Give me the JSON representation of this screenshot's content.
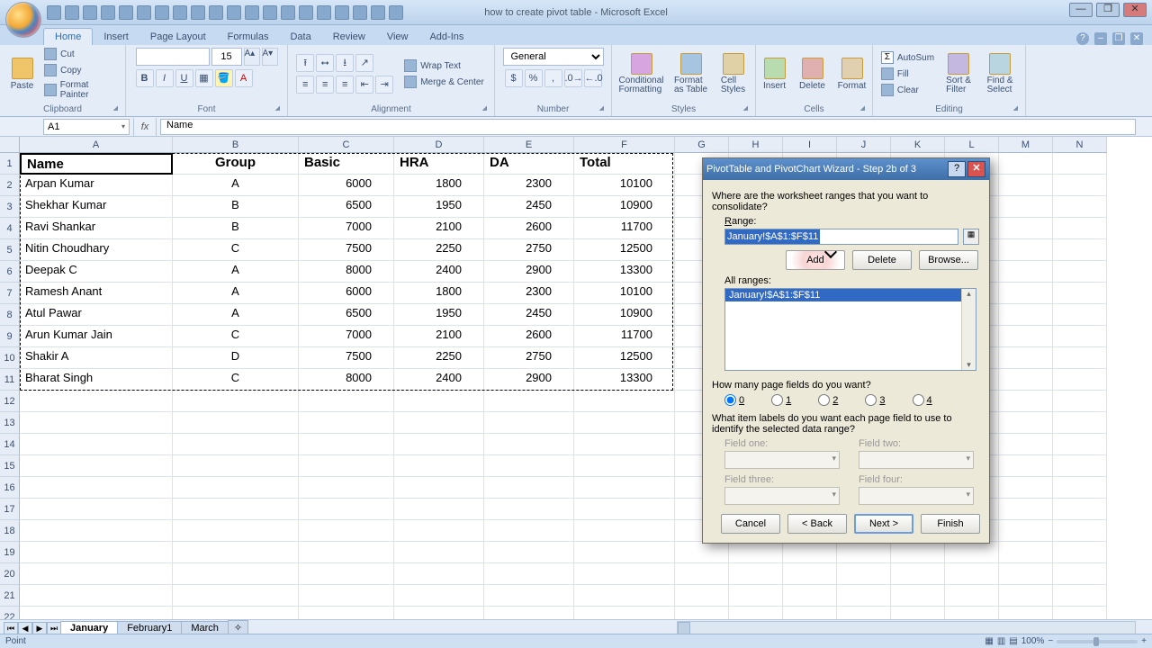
{
  "title": "how to create pivot table - Microsoft Excel",
  "tabs": [
    "Home",
    "Insert",
    "Page Layout",
    "Formulas",
    "Data",
    "Review",
    "View",
    "Add-Ins"
  ],
  "activeTab": "Home",
  "ribbon": {
    "clipboard": {
      "label": "Clipboard",
      "paste": "Paste",
      "cut": "Cut",
      "copy": "Copy",
      "fmtpainter": "Format Painter"
    },
    "font": {
      "label": "Font",
      "size": "15"
    },
    "alignment": {
      "label": "Alignment",
      "wrap": "Wrap Text",
      "merge": "Merge & Center"
    },
    "number": {
      "label": "Number",
      "general": "General"
    },
    "styles": {
      "label": "Styles",
      "cond": "Conditional\nFormatting",
      "fmt": "Format\nas Table",
      "cell": "Cell\nStyles"
    },
    "cells": {
      "label": "Cells",
      "insert": "Insert",
      "delete": "Delete",
      "format": "Format"
    },
    "editing": {
      "label": "Editing",
      "sum": "AutoSum",
      "fill": "Fill",
      "clear": "Clear",
      "sort": "Sort &\nFilter",
      "find": "Find &\nSelect"
    }
  },
  "namebox": "A1",
  "formula": "Name",
  "columns": [
    "A",
    "B",
    "C",
    "D",
    "E",
    "F",
    "G",
    "H",
    "I",
    "J",
    "K",
    "L",
    "M",
    "N"
  ],
  "headers": [
    "Name",
    "Group",
    "Basic",
    "HRA",
    "DA",
    "Total"
  ],
  "rows": [
    {
      "name": "Arpan Kumar",
      "group": "A",
      "basic": 6000,
      "hra": 1800,
      "da": 2300,
      "total": 10100
    },
    {
      "name": "Shekhar Kumar",
      "group": "B",
      "basic": 6500,
      "hra": 1950,
      "da": 2450,
      "total": 10900
    },
    {
      "name": "Ravi Shankar",
      "group": "B",
      "basic": 7000,
      "hra": 2100,
      "da": 2600,
      "total": 11700
    },
    {
      "name": "Nitin Choudhary",
      "group": "C",
      "basic": 7500,
      "hra": 2250,
      "da": 2750,
      "total": 12500
    },
    {
      "name": "Deepak C",
      "group": "A",
      "basic": 8000,
      "hra": 2400,
      "da": 2900,
      "total": 13300
    },
    {
      "name": "Ramesh Anant",
      "group": "A",
      "basic": 6000,
      "hra": 1800,
      "da": 2300,
      "total": 10100
    },
    {
      "name": "Atul Pawar",
      "group": "A",
      "basic": 6500,
      "hra": 1950,
      "da": 2450,
      "total": 10900
    },
    {
      "name": "Arun Kumar Jain",
      "group": "C",
      "basic": 7000,
      "hra": 2100,
      "da": 2600,
      "total": 11700
    },
    {
      "name": "Shakir A",
      "group": "D",
      "basic": 7500,
      "hra": 2250,
      "da": 2750,
      "total": 12500
    },
    {
      "name": "Bharat Singh",
      "group": "C",
      "basic": 8000,
      "hra": 2400,
      "da": 2900,
      "total": 13300
    }
  ],
  "sheets": [
    "January",
    "February1",
    "March"
  ],
  "activeSheet": "January",
  "status": "Point",
  "zoom": "100%",
  "dialog": {
    "title": "PivotTable and PivotChart Wizard - Step 2b of 3",
    "prompt": "Where are the worksheet ranges that you want to consolidate?",
    "rangeLabel": "Range:",
    "rangeValue": "January!$A$1:$F$11",
    "add": "Add",
    "delete": "Delete",
    "browse": "Browse...",
    "allRangesLabel": "All ranges:",
    "allRangesItem": "January!$A$1:$F$11",
    "pageQ": "How many page fields do you want?",
    "pageOpts": [
      "0",
      "1",
      "2",
      "3",
      "4"
    ],
    "pageSelected": "0",
    "itemQ": "What item labels do you want each page field to use to identify the selected data range?",
    "fields": [
      "Field one:",
      "Field two:",
      "Field three:",
      "Field four:"
    ],
    "cancel": "Cancel",
    "back": "< Back",
    "next": "Next >",
    "finish": "Finish"
  }
}
